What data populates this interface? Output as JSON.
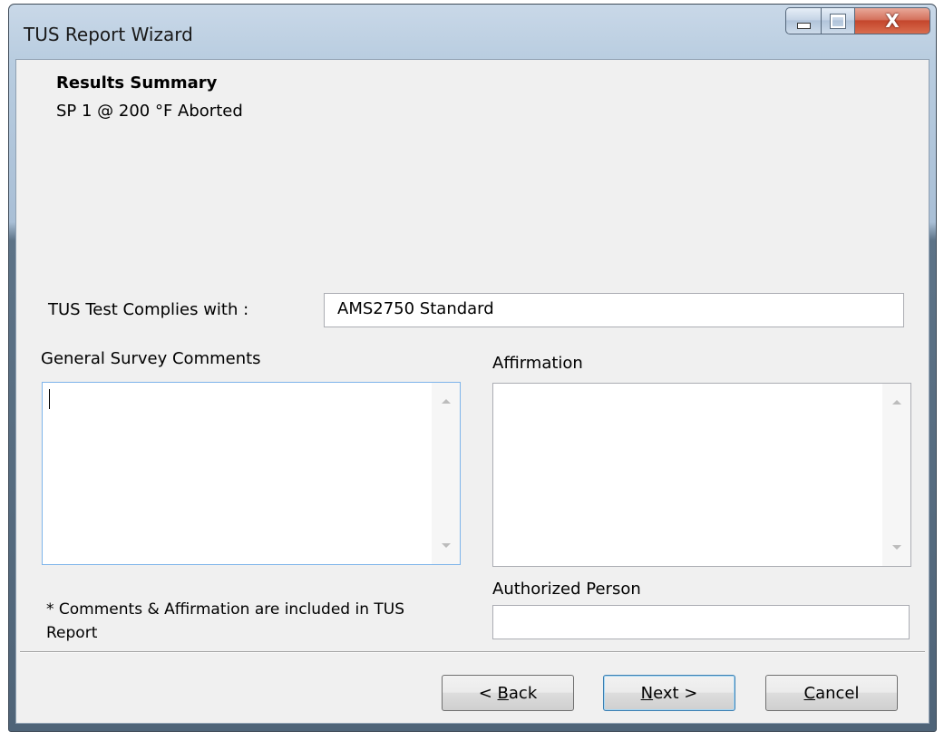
{
  "window": {
    "title": "TUS Report Wizard",
    "caption_buttons": {
      "minimize_icon": "minimize-icon",
      "maximize_icon": "maximize-icon",
      "close_icon": "close-icon",
      "close_glyph": "X"
    }
  },
  "summary": {
    "heading": "Results Summary",
    "status": "SP 1 @ 200 °F  Aborted"
  },
  "complies": {
    "label": "TUS Test Complies with :",
    "value": "AMS2750 Standard"
  },
  "comments": {
    "label": "General Survey Comments",
    "value": ""
  },
  "affirmation": {
    "label": "Affirmation",
    "value": ""
  },
  "authorized_person": {
    "label": "Authorized Person",
    "value": ""
  },
  "note": "* Comments & Affirmation are included in TUS Report",
  "buttons": {
    "back": {
      "prefix": "< ",
      "mnemonic": "B",
      "rest": "ack"
    },
    "next": {
      "mnemonic": "N",
      "rest": "ext >"
    },
    "cancel": {
      "mnemonic": "C",
      "rest": "ancel"
    }
  },
  "colors": {
    "client_bg": "#f0f0f0",
    "focus_border": "#7eb4ea",
    "close_red": "#c4462c"
  }
}
